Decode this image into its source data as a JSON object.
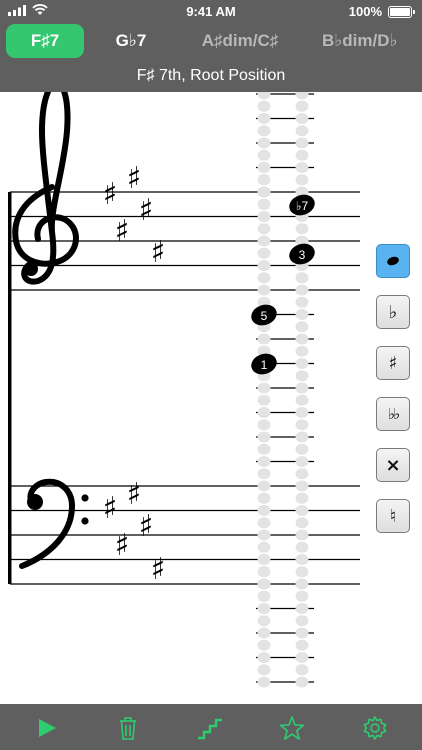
{
  "status_bar": {
    "time": "9:41 AM",
    "battery_percent": "100%"
  },
  "chord_tabs": [
    {
      "label": "F♯7",
      "active": true
    },
    {
      "label": "G♭7",
      "active": false
    },
    {
      "label": "A♯dim/C♯",
      "active": false
    },
    {
      "label": "B♭dim/D♭",
      "active": false
    }
  ],
  "chord_subtitle": "F♯ 7th, Root Position",
  "notes": [
    {
      "degree": "♭7"
    },
    {
      "degree": "3"
    },
    {
      "degree": "5"
    },
    {
      "degree": "1"
    }
  ],
  "accidentals": [
    {
      "name": "natural-note",
      "symbol": "●",
      "selected": true
    },
    {
      "name": "flat",
      "symbol": "♭",
      "selected": false
    },
    {
      "name": "sharp",
      "symbol": "♯",
      "selected": false
    },
    {
      "name": "double-flat",
      "symbol": "♭♭",
      "selected": false
    },
    {
      "name": "double-sharp",
      "symbol": "×",
      "selected": false
    },
    {
      "name": "natural",
      "symbol": "♮",
      "selected": false
    }
  ],
  "toolbar": [
    {
      "name": "play-icon"
    },
    {
      "name": "trash-icon"
    },
    {
      "name": "stairs-icon"
    },
    {
      "name": "star-icon"
    },
    {
      "name": "gear-icon"
    }
  ],
  "colors": {
    "bar_gray": "#5f5f5f",
    "accent_green": "#34c76f",
    "selected_blue": "#5ab3f0"
  }
}
